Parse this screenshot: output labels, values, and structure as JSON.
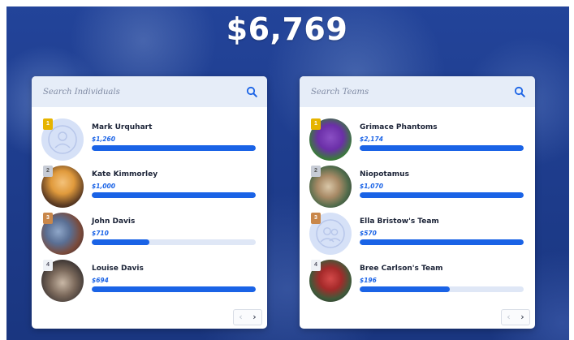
{
  "total": "$6,769",
  "individuals": {
    "search_placeholder": "Search Individuals",
    "items": [
      {
        "rank": "1",
        "name": "Mark Urquhart",
        "amount": "$1,260",
        "progress": 1.0,
        "avatar": "person-placeholder"
      },
      {
        "rank": "2",
        "name": "Kate Kimmorley",
        "amount": "$1,000",
        "progress": 1.0,
        "avatar": "photo"
      },
      {
        "rank": "3",
        "name": "John Davis",
        "amount": "$710",
        "progress": 0.35,
        "avatar": "photo"
      },
      {
        "rank": "4",
        "name": "Louise Davis",
        "amount": "$694",
        "progress": 1.0,
        "avatar": "photo"
      }
    ]
  },
  "teams": {
    "search_placeholder": "Search Teams",
    "items": [
      {
        "rank": "1",
        "name": "Grimace Phantoms",
        "amount": "$2,174",
        "progress": 1.0,
        "avatar": "photo"
      },
      {
        "rank": "2",
        "name": "Niopotamus",
        "amount": "$1,070",
        "progress": 1.0,
        "avatar": "photo"
      },
      {
        "rank": "3",
        "name": "Ella Bristow's Team",
        "amount": "$570",
        "progress": 1.0,
        "avatar": "team-placeholder"
      },
      {
        "rank": "4",
        "name": "Bree Carlson's Team",
        "amount": "$196",
        "progress": 0.55,
        "avatar": "photo"
      }
    ]
  },
  "pager": {
    "prev": "‹",
    "next": "›"
  },
  "colors": {
    "accent": "#1a63e6",
    "track": "#dfe7f6",
    "background": "#1f3f8f"
  }
}
